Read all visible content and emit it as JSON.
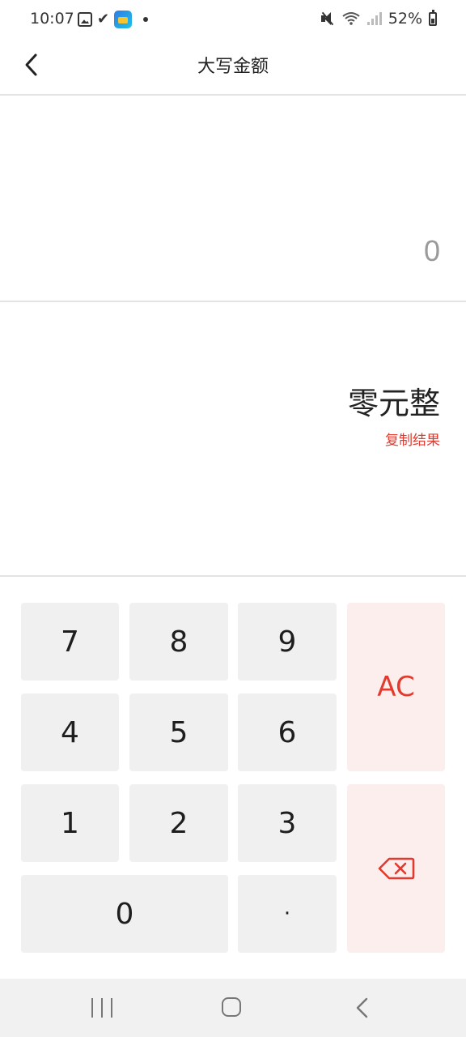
{
  "status_bar": {
    "time": "10:07",
    "battery_text": "52%",
    "icons": [
      "gallery-icon",
      "check-icon",
      "app-icon",
      "notification-dot-icon",
      "mute-icon",
      "wifi-icon",
      "signal-icon",
      "battery-icon"
    ]
  },
  "header": {
    "title": "大写金额",
    "back_icon": "chevron-left-icon"
  },
  "input": {
    "value": "0"
  },
  "result": {
    "text": "零元整",
    "copy_label": "复制结果"
  },
  "keypad": {
    "keys": {
      "k7": "7",
      "k8": "8",
      "k9": "9",
      "k4": "4",
      "k5": "5",
      "k6": "6",
      "k1": "1",
      "k2": "2",
      "k3": "3",
      "k0": "0",
      "dot": "·",
      "ac": "AC"
    },
    "backspace_icon": "backspace-icon",
    "accent_color": "#e23a2e",
    "key_color": "#f0f0f0",
    "special_key_color": "#fdeeee"
  },
  "nav_bar": {
    "icons": [
      "recent-apps-icon",
      "home-icon",
      "nav-back-icon"
    ]
  }
}
